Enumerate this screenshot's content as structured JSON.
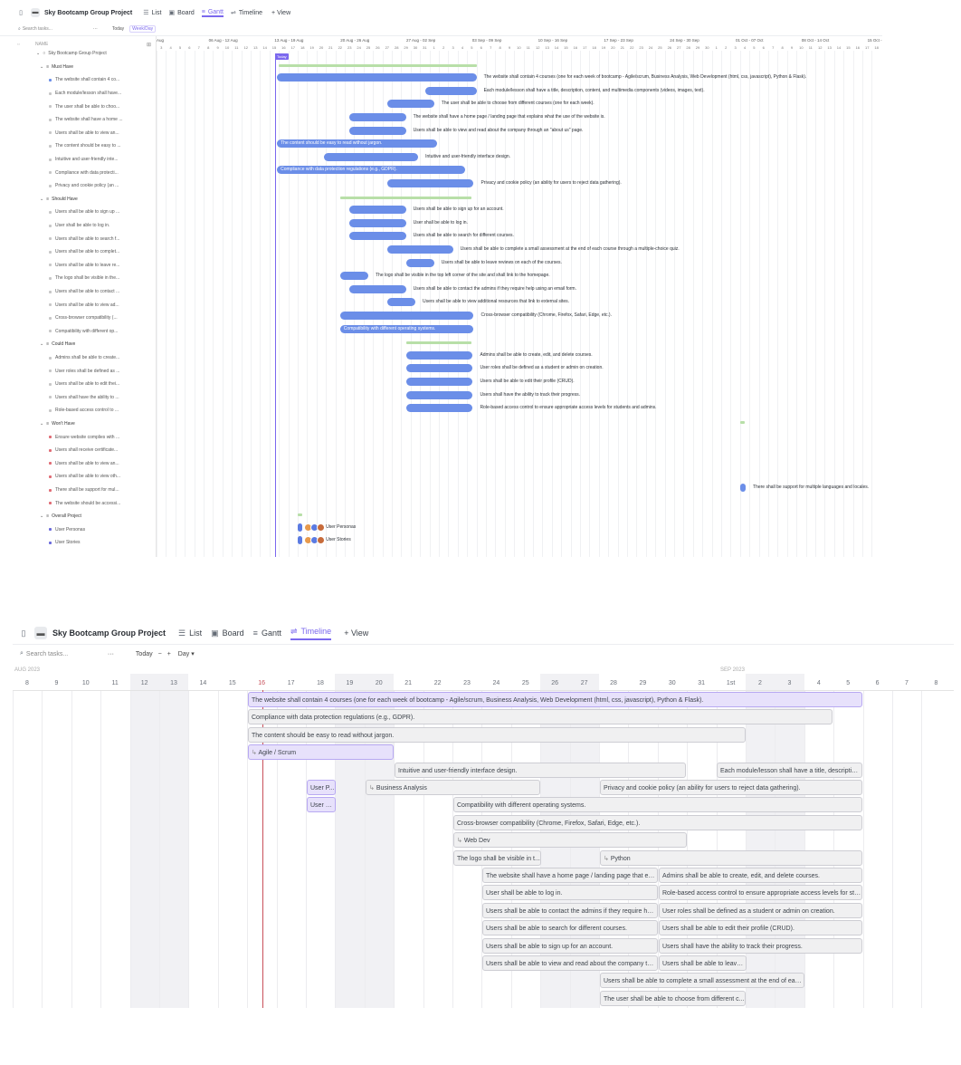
{
  "gantt": {
    "toolbar": {
      "title": "Sky Bootcamp Group Project",
      "views": [
        "List",
        "Board",
        "Gantt",
        "Timeline"
      ],
      "active_view": "Gantt",
      "add_view": "+ View"
    },
    "subbar": {
      "search_placeholder": "Search tasks...",
      "more": "···",
      "today": "Today",
      "scale": "Week/Day"
    },
    "name_header": "NAME",
    "week_headers": [
      "Aug",
      "06 Aug - 12 Aug",
      "13 Aug - 19 Aug",
      "20 Aug - 26 Aug",
      "27 Aug - 02 Sep",
      "03 Sep - 09 Sep",
      "10 Sep - 16 Sep",
      "17 Sep - 23 Sep",
      "24 Sep - 30 Sep",
      "01 Oct - 07 Oct",
      "08 Oct - 14 Oct",
      "15 Oct - 21"
    ],
    "day_numbers": [
      "3",
      "4",
      "5",
      "6",
      "7",
      "8",
      "9",
      "10",
      "11",
      "12",
      "13",
      "14",
      "15",
      "16",
      "17",
      "18",
      "19",
      "20",
      "21",
      "22",
      "23",
      "24",
      "25",
      "26",
      "27",
      "28",
      "29",
      "30",
      "31",
      "1",
      "2",
      "3",
      "4",
      "5",
      "6",
      "7",
      "8",
      "9",
      "10",
      "11",
      "12",
      "13",
      "14",
      "15",
      "16",
      "17",
      "18",
      "19",
      "20",
      "21",
      "22",
      "23",
      "24",
      "25",
      "26",
      "27",
      "28",
      "29",
      "30",
      "1",
      "2",
      "3",
      "4",
      "5",
      "6",
      "7",
      "8",
      "9",
      "10",
      "11",
      "12",
      "13",
      "14",
      "15",
      "16",
      "17",
      "18"
    ],
    "today_label": "Today",
    "rows": [
      {
        "kind": "project",
        "name": "Sky Bootcamp Group Project"
      },
      {
        "kind": "group",
        "name": "Must Have"
      },
      {
        "kind": "task",
        "name": "The website shall contain 4 co...",
        "color": "#6b8ee8",
        "bar_label": "The website shall contain 4 courses (one for each week of bootcamp - Agile/scrum, Business Analysis, Web Development (html, css, javascript), Python & Flask)."
      },
      {
        "kind": "task",
        "name": "Each module/lesson shall have...",
        "color": "#c7c7c7",
        "bar_label": "Each module/lesson shall have a title, description, content, and multimedia components (videos, images, text)."
      },
      {
        "kind": "task",
        "name": "The user shall be able to choo...",
        "color": "#c7c7c7",
        "bar_label": "The user shall be able to choose from different courses (one for each week)."
      },
      {
        "kind": "task",
        "name": "The website shall have a home ...",
        "color": "#c7c7c7",
        "bar_label": "The website shall have a home page / landing page that explains what the use of the website is."
      },
      {
        "kind": "task",
        "name": "Users shall be able to view an...",
        "color": "#c7c7c7",
        "bar_label": "Users shall be able to view and read about the company through an \"about us\" page."
      },
      {
        "kind": "task",
        "name": "The content should be easy to ...",
        "color": "#c7c7c7",
        "bar_label": "The content should be easy to read without jargon."
      },
      {
        "kind": "task",
        "name": "Intuitive and user-friendly inte...",
        "color": "#c7c7c7",
        "bar_label": "Intuitive and user-friendly interface design."
      },
      {
        "kind": "task",
        "name": "Compliance with data protecti...",
        "color": "#c7c7c7",
        "bar_label": "Compliance with data protection regulations (e.g., GDPR)."
      },
      {
        "kind": "task",
        "name": "Privacy and cookie policy (an ...",
        "color": "#c7c7c7",
        "bar_label": "Privacy and cookie policy (an ability for users to reject data gathering)."
      },
      {
        "kind": "group",
        "name": "Should Have"
      },
      {
        "kind": "task",
        "name": "Users shall be able to sign up ...",
        "color": "#c7c7c7",
        "bar_label": "Users shall be able to sign up for an account."
      },
      {
        "kind": "task",
        "name": "User shall be able to log in.",
        "color": "#c7c7c7",
        "bar_label": "User shall be able to log in."
      },
      {
        "kind": "task",
        "name": "Users shall be able to search f...",
        "color": "#c7c7c7",
        "bar_label": "Users shall be able to search for different courses."
      },
      {
        "kind": "task",
        "name": "Users shall be able to complet...",
        "color": "#c7c7c7",
        "bar_label": "Users shall be able to complete a small assessment at the end of each course through a multiple-choice quiz."
      },
      {
        "kind": "task",
        "name": "Users shall be able to leave re...",
        "color": "#c7c7c7",
        "bar_label": "Users shall be able to leave reviews on each of the courses."
      },
      {
        "kind": "task",
        "name": "The logo shall be visible in the...",
        "color": "#c7c7c7",
        "bar_label": "The logo shall be visible in the top left corner of the site and shall link to the homepage."
      },
      {
        "kind": "task",
        "name": "Users shall be able to contact ...",
        "color": "#c7c7c7",
        "bar_label": "Users shall be able to contact the admins if they require help using an email form."
      },
      {
        "kind": "task",
        "name": "Users shall be able to view ad...",
        "color": "#c7c7c7",
        "bar_label": "Users shall be able to view additional resources that link to external sites."
      },
      {
        "kind": "task",
        "name": "Cross-browser compatibility (...",
        "color": "#c7c7c7",
        "bar_label": "Cross-browser compatibility (Chrome, Firefox, Safari, Edge, etc.)."
      },
      {
        "kind": "task",
        "name": "Compatibility with different op...",
        "color": "#c7c7c7",
        "bar_label": "Compatibility with different operating systems."
      },
      {
        "kind": "group",
        "name": "Could Have"
      },
      {
        "kind": "task",
        "name": "Admins shall be able to create...",
        "color": "#c7c7c7",
        "bar_label": "Admins shall be able to create, edit, and delete courses."
      },
      {
        "kind": "task",
        "name": "User roles shall be defined as ...",
        "color": "#c7c7c7",
        "bar_label": "User roles shall be defined as a student or admin on creation."
      },
      {
        "kind": "task",
        "name": "Users shall be able to edit thei...",
        "color": "#c7c7c7",
        "bar_label": "Users shall be able to edit their profile (CRUD)."
      },
      {
        "kind": "task",
        "name": "Users shall have the ability to ...",
        "color": "#c7c7c7",
        "bar_label": "Users shall have the ability to track their progress."
      },
      {
        "kind": "task",
        "name": "Role-based access control to ...",
        "color": "#c7c7c7",
        "bar_label": "Role-based access control to ensure appropriate access levels for students and admins."
      },
      {
        "kind": "group",
        "name": "Won't Have"
      },
      {
        "kind": "task",
        "name": "Ensure website complies with ...",
        "color": "#e06c75",
        "bar_label": ""
      },
      {
        "kind": "task",
        "name": "Users shall receive certificate...",
        "color": "#e06c75",
        "bar_label": ""
      },
      {
        "kind": "task",
        "name": "Users shall be able to view an...",
        "color": "#e06c75",
        "bar_label": ""
      },
      {
        "kind": "task",
        "name": "Users shall be able to view oth...",
        "color": "#e06c75",
        "bar_label": ""
      },
      {
        "kind": "task",
        "name": "There shall be support for mul...",
        "color": "#e06c75",
        "bar_label": "There shall be support for multiple languages and locales."
      },
      {
        "kind": "task",
        "name": "The website should be accessi...",
        "color": "#e06c75",
        "bar_label": ""
      },
      {
        "kind": "group",
        "name": "Overall Project"
      },
      {
        "kind": "task",
        "name": "User Personas",
        "color": "#6b6bdb",
        "bar_label": "User Personas"
      },
      {
        "kind": "task",
        "name": "User Stories",
        "color": "#6b6bdb",
        "bar_label": "User Stories"
      }
    ]
  },
  "timeline": {
    "toolbar": {
      "title": "Sky Bootcamp Group Project",
      "views": [
        "List",
        "Board",
        "Gantt",
        "Timeline"
      ],
      "active_view": "Timeline",
      "add_view": "+ View"
    },
    "subbar": {
      "search_placeholder": "Search tasks...",
      "more": "···",
      "today": "Today",
      "zoom_out": "−",
      "zoom_in": "+",
      "scale": "Day"
    },
    "month_labels": [
      "AUG 2023",
      "SEP 2023"
    ],
    "days": [
      "8",
      "9",
      "10",
      "11",
      "12",
      "13",
      "14",
      "15",
      "16",
      "17",
      "18",
      "19",
      "20",
      "21",
      "22",
      "23",
      "24",
      "25",
      "26",
      "27",
      "28",
      "29",
      "30",
      "31",
      "1st",
      "2",
      "3",
      "4",
      "5",
      "6",
      "7",
      "8"
    ],
    "today_day": "16",
    "bars": [
      "The website shall contain 4 courses (one for each week of bootcamp - Agile/scrum, Business Analysis, Web Development (html, css, javascript), Python & Flask).",
      "Compliance with data protection regulations (e.g., GDPR).",
      "The content should be easy to read without jargon.",
      "Agile / Scrum",
      "Intuitive and user-friendly interface design.",
      "Each module/lesson shall have a title, description...",
      "User P...",
      "Business Analysis",
      "Privacy and cookie policy (an ability for users to reject data gathering).",
      "User S...",
      "Compatibility with different operating systems.",
      "Cross-browser compatibility (Chrome, Firefox, Safari, Edge, etc.).",
      "Web Dev",
      "The logo shall be visible in t...",
      "Python",
      "The website shall have a home page / landing page that exp...",
      "Admins shall be able to create, edit, and delete courses.",
      "User shall be able to log in.",
      "Role-based access control to ensure appropriate access levels for stu...",
      "Users shall be able to contact the admins if they require hel...",
      "User roles shall be defined as a student or admin on creation.",
      "Users shall be able to search for different courses.",
      "Users shall be able to edit their profile (CRUD).",
      "Users shall be able to sign up for an account.",
      "Users shall have the ability to track their progress.",
      "Users shall be able to view and read about the company thr...",
      "Users shall be able to leave ...",
      "Users shall be able to complete a small assessment at the end of each...",
      "The user shall be able to choose from different c...",
      "Users shall be able to view ..."
    ]
  }
}
